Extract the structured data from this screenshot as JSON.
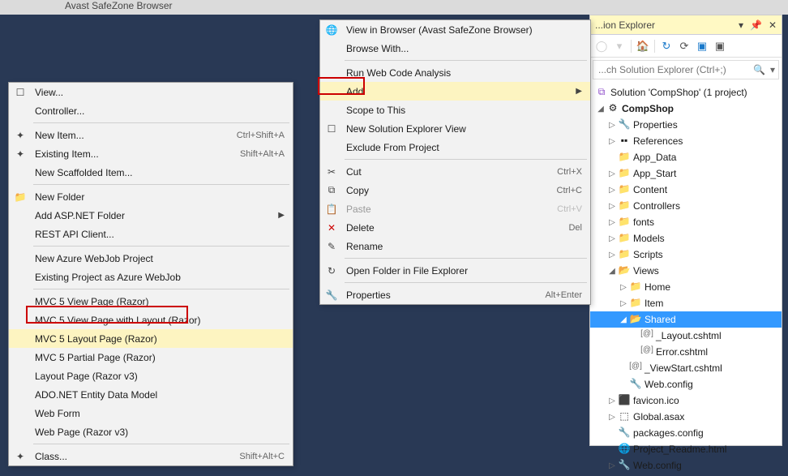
{
  "title_bar": {
    "app_fragment": "Avast SafeZone Browser"
  },
  "solution_explorer": {
    "title": "...ion Explorer",
    "search_placeholder": "...ch Solution Explorer (Ctrl+;)",
    "toolbar": {
      "pin": "📌",
      "close": "✕",
      "dropdown": "▾"
    },
    "tree": {
      "solution": "Solution 'CompShop' (1 project)",
      "project": "CompShop",
      "properties": "Properties",
      "references": "References",
      "app_data": "App_Data",
      "app_start": "App_Start",
      "content": "Content",
      "controllers": "Controllers",
      "fonts": "fonts",
      "models": "Models",
      "scripts": "Scripts",
      "views": "Views",
      "home": "Home",
      "item": "Item",
      "shared": "Shared",
      "layout_cshtml": "_Layout.cshtml",
      "error_cshtml": "Error.cshtml",
      "viewstart_cshtml": "_ViewStart.cshtml",
      "web_config_views": "Web.config",
      "favicon": "favicon.ico",
      "global_asax": "Global.asax",
      "packages_config": "packages.config",
      "project_readme": "Project_Readme.html",
      "web_config": "Web.config"
    }
  },
  "context_menu": {
    "items": [
      {
        "label": "View in Browser (Avast SafeZone Browser)",
        "icon": "🌐"
      },
      {
        "label": "Browse With..."
      },
      {
        "sep": true
      },
      {
        "label": "Run Web Code Analysis"
      },
      {
        "label": "Add",
        "arrow": true,
        "hi": true
      },
      {
        "label": "Scope to This"
      },
      {
        "label": "New Solution Explorer View",
        "icon": "☐"
      },
      {
        "label": "Exclude From Project"
      },
      {
        "sep": true
      },
      {
        "label": "Cut",
        "icon": "✂",
        "shortcut": "Ctrl+X"
      },
      {
        "label": "Copy",
        "icon": "⧉",
        "shortcut": "Ctrl+C"
      },
      {
        "label": "Paste",
        "icon": "📋",
        "shortcut": "Ctrl+V",
        "disabled": true
      },
      {
        "label": "Delete",
        "icon": "✕",
        "shortcut": "Del",
        "danger": true
      },
      {
        "label": "Rename",
        "icon": "✎"
      },
      {
        "sep": true
      },
      {
        "label": "Open Folder in File Explorer",
        "icon": "↻"
      },
      {
        "sep": true
      },
      {
        "label": "Properties",
        "icon": "🔧",
        "shortcut": "Alt+Enter"
      }
    ]
  },
  "add_submenu": {
    "items": [
      {
        "label": "View...",
        "icon": "☐"
      },
      {
        "label": "Controller..."
      },
      {
        "sep": true
      },
      {
        "label": "New Item...",
        "icon": "✦",
        "shortcut": "Ctrl+Shift+A"
      },
      {
        "label": "Existing Item...",
        "icon": "✦",
        "shortcut": "Shift+Alt+A"
      },
      {
        "label": "New Scaffolded Item..."
      },
      {
        "sep": true
      },
      {
        "label": "New Folder",
        "icon": "📁"
      },
      {
        "label": "Add ASP.NET Folder",
        "arrow": true
      },
      {
        "label": "REST API Client..."
      },
      {
        "sep": true
      },
      {
        "label": "New Azure WebJob Project"
      },
      {
        "label": "Existing Project as Azure WebJob"
      },
      {
        "sep": true
      },
      {
        "label": "MVC 5 View Page (Razor)"
      },
      {
        "label": "MVC 5 View Page with Layout (Razor)"
      },
      {
        "label": "MVC 5 Layout Page (Razor)",
        "hi": true
      },
      {
        "label": "MVC 5 Partial Page (Razor)"
      },
      {
        "label": "Layout Page (Razor v3)"
      },
      {
        "label": "ADO.NET Entity Data Model"
      },
      {
        "label": "Web Form"
      },
      {
        "label": "Web Page (Razor v3)"
      },
      {
        "sep": true
      },
      {
        "label": "Class...",
        "icon": "✦",
        "shortcut": "Shift+Alt+C"
      }
    ]
  }
}
